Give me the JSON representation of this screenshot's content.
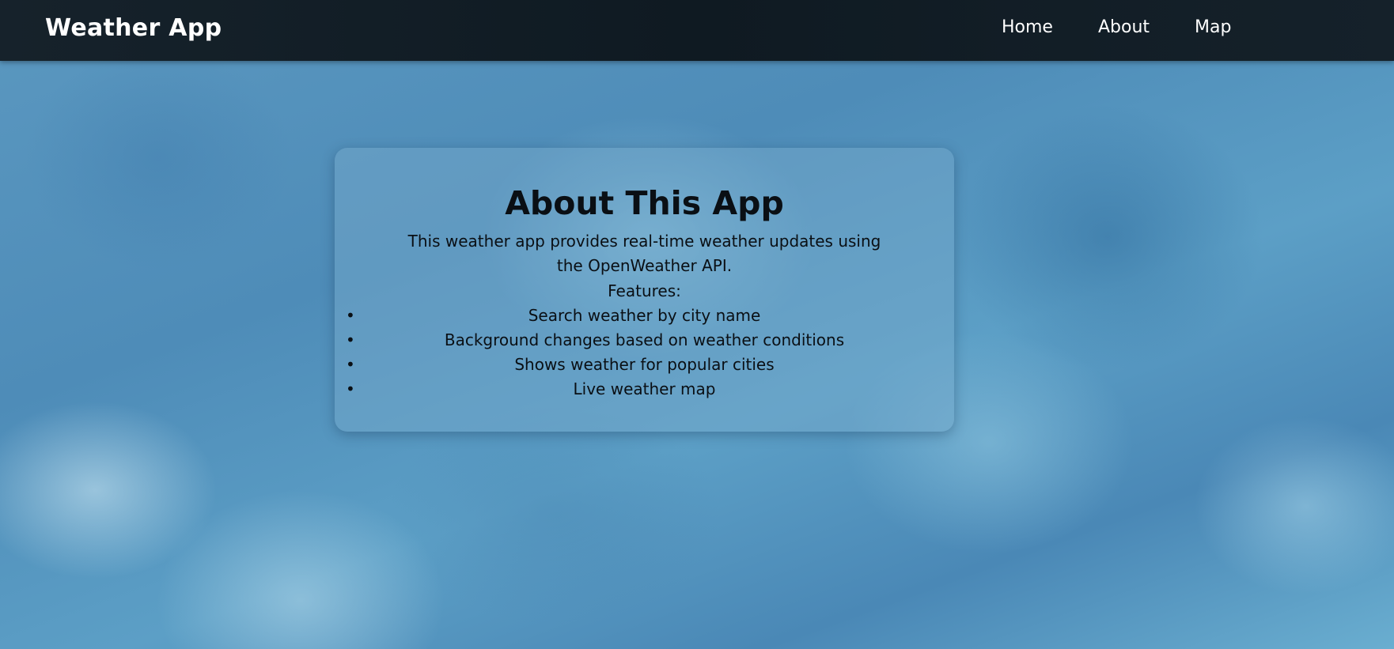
{
  "navbar": {
    "brand": "Weather App",
    "links": [
      {
        "label": "Home"
      },
      {
        "label": "About"
      },
      {
        "label": "Map"
      }
    ]
  },
  "about": {
    "title": "About This App",
    "description": "This weather app provides real-time weather updates using the OpenWeather API.",
    "features_label": "Features:",
    "features": [
      "Search weather by city name",
      "Background changes based on weather conditions",
      "Shows weather for popular cities",
      "Live weather map"
    ]
  },
  "colors": {
    "navbar_bg": "#111c24",
    "text_light": "#ffffff",
    "text_dark": "#0a0f14",
    "sky_blue": "#5a9cc4"
  }
}
